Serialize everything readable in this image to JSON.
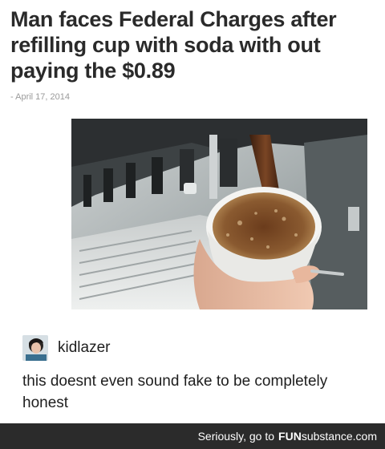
{
  "article": {
    "title": "Man faces Federal Charges after refilling cup with soda with out paying the $0.89",
    "date": "- April 17, 2014"
  },
  "post": {
    "username": "kidlazer",
    "avatar_icon": "user-avatar-icon",
    "text": "this doesnt even sound fake to be completely honest"
  },
  "footer": {
    "prefix": "Seriously, go to",
    "brand_part1": "FUN",
    "brand_part2": "substance",
    "brand_part3": ".com"
  },
  "colors": {
    "headline": "#2a2a2a",
    "date": "#9a9a9a",
    "footer_bg": "#2b2b2b",
    "soda": "#4a2a17"
  }
}
